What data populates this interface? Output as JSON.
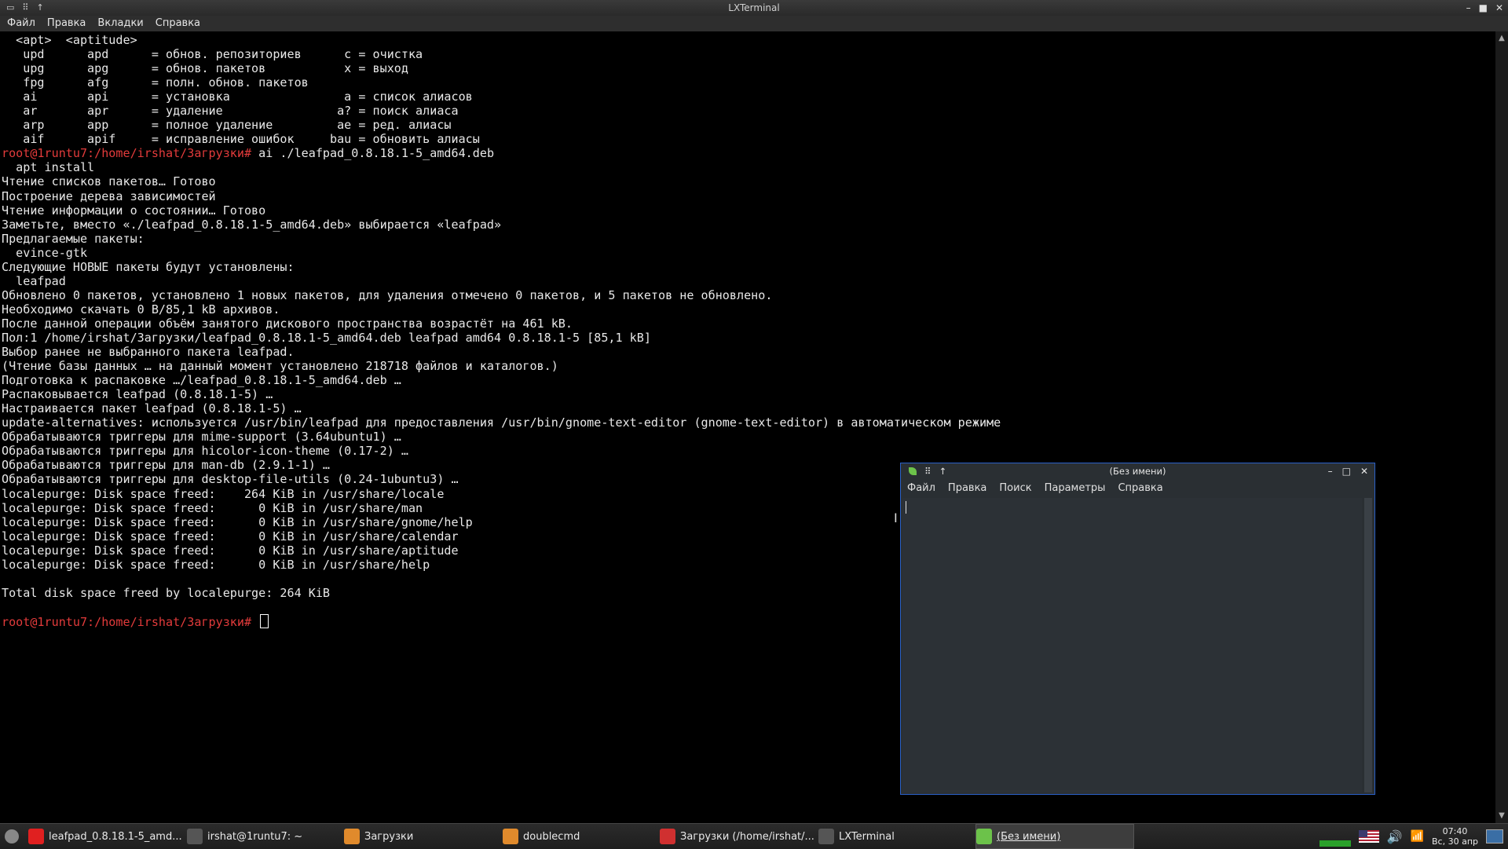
{
  "terminal": {
    "title": "LXTerminal",
    "menu": [
      "Файл",
      "Правка",
      "Вкладки",
      "Справка"
    ],
    "prompt": "root@1runtu7:/home/irshat/Загрузки#",
    "lines": [
      {
        "text": "  <apt>  <aptitude>"
      },
      {
        "text": "   upd      apd      = обнов. репозиториев      c = очистка"
      },
      {
        "text": "   upg      apg      = обнов. пакетов           x = выход"
      },
      {
        "text": "   fpg      afg      = полн. обнов. пакетов"
      },
      {
        "text": "   ai       api      = установка                a = список алиасов"
      },
      {
        "text": "   ar       apr      = удаление                a? = поиск алиаса"
      },
      {
        "text": "   arp      app      = полное удаление         ae = ред. алиасы"
      },
      {
        "text": "   aif      apif     = исправление ошибок     bau = обновить алиасы"
      },
      {
        "prompt": true,
        "text": " ai ./leafpad_0.8.18.1-5_amd64.deb"
      },
      {
        "text": "  apt install"
      },
      {
        "text": "Чтение списков пакетов… Готово"
      },
      {
        "text": "Построение дерева зависимостей"
      },
      {
        "text": "Чтение информации о состоянии… Готово"
      },
      {
        "text": "Заметьте, вместо «./leafpad_0.8.18.1-5_amd64.deb» выбирается «leafpad»"
      },
      {
        "text": "Предлагаемые пакеты:"
      },
      {
        "text": "  evince-gtk"
      },
      {
        "text": "Следующие НОВЫЕ пакеты будут установлены:"
      },
      {
        "text": "  leafpad"
      },
      {
        "text": "Обновлено 0 пакетов, установлено 1 новых пакетов, для удаления отмечено 0 пакетов, и 5 пакетов не обновлено."
      },
      {
        "text": "Необходимо скачать 0 B/85,1 kB архивов."
      },
      {
        "text": "После данной операции объём занятого дискового пространства возрастёт на 461 kB."
      },
      {
        "text": "Пол:1 /home/irshat/Загрузки/leafpad_0.8.18.1-5_amd64.deb leafpad amd64 0.8.18.1-5 [85,1 kB]"
      },
      {
        "text": "Выбор ранее не выбранного пакета leafpad."
      },
      {
        "text": "(Чтение базы данных … на данный момент установлено 218718 файлов и каталогов.)"
      },
      {
        "text": "Подготовка к распаковке …/leafpad_0.8.18.1-5_amd64.deb …"
      },
      {
        "text": "Распаковывается leafpad (0.8.18.1-5) …"
      },
      {
        "text": "Настраивается пакет leafpad (0.8.18.1-5) …"
      },
      {
        "text": "update-alternatives: используется /usr/bin/leafpad для предоставления /usr/bin/gnome-text-editor (gnome-text-editor) в автоматическом режиме"
      },
      {
        "text": "Обрабатываются триггеры для mime-support (3.64ubuntu1) …"
      },
      {
        "text": "Обрабатываются триггеры для hicolor-icon-theme (0.17-2) …"
      },
      {
        "text": "Обрабатываются триггеры для man-db (2.9.1-1) …"
      },
      {
        "text": "Обрабатываются триггеры для desktop-file-utils (0.24-1ubuntu3) …"
      },
      {
        "text": "localepurge: Disk space freed:    264 KiB in /usr/share/locale"
      },
      {
        "text": "localepurge: Disk space freed:      0 KiB in /usr/share/man"
      },
      {
        "text": "localepurge: Disk space freed:      0 KiB in /usr/share/gnome/help"
      },
      {
        "text": "localepurge: Disk space freed:      0 KiB in /usr/share/calendar"
      },
      {
        "text": "localepurge: Disk space freed:      0 KiB in /usr/share/aptitude"
      },
      {
        "text": "localepurge: Disk space freed:      0 KiB in /usr/share/help"
      },
      {
        "text": ""
      },
      {
        "text": "Total disk space freed by localepurge: 264 KiB"
      },
      {
        "text": ""
      },
      {
        "prompt": true,
        "text": " ",
        "cursor": true
      }
    ]
  },
  "leafpad": {
    "title": "(Без имени)",
    "menu": [
      "Файл",
      "Правка",
      "Поиск",
      "Параметры",
      "Справка"
    ]
  },
  "taskbar": {
    "items": [
      {
        "label": "leafpad_0.8.18.1-5_amd...",
        "icon": "yandex-browser-icon",
        "color": "#e02020"
      },
      {
        "label": "irshat@1runtu7: ~",
        "icon": "terminal-icon",
        "color": "#555555"
      },
      {
        "label": "Загрузки",
        "icon": "folder-icon",
        "color": "#e08a2c"
      },
      {
        "label": "doublecmd",
        "icon": "folder-icon",
        "color": "#e08a2c"
      },
      {
        "label": "Загрузки (/home/irshat/...",
        "icon": "doublecmd-icon",
        "color": "#d03030"
      },
      {
        "label": "LXTerminal",
        "icon": "terminal-icon",
        "color": "#555555"
      },
      {
        "label": "(Без имени)",
        "icon": "leafpad-icon",
        "color": "#6cc24a",
        "active": true
      }
    ],
    "clock_time": "07:40",
    "clock_date": "Вс, 30 апр"
  },
  "colors": {
    "prompt": "#e33b3b",
    "leafpad_border": "#2a60c8"
  }
}
